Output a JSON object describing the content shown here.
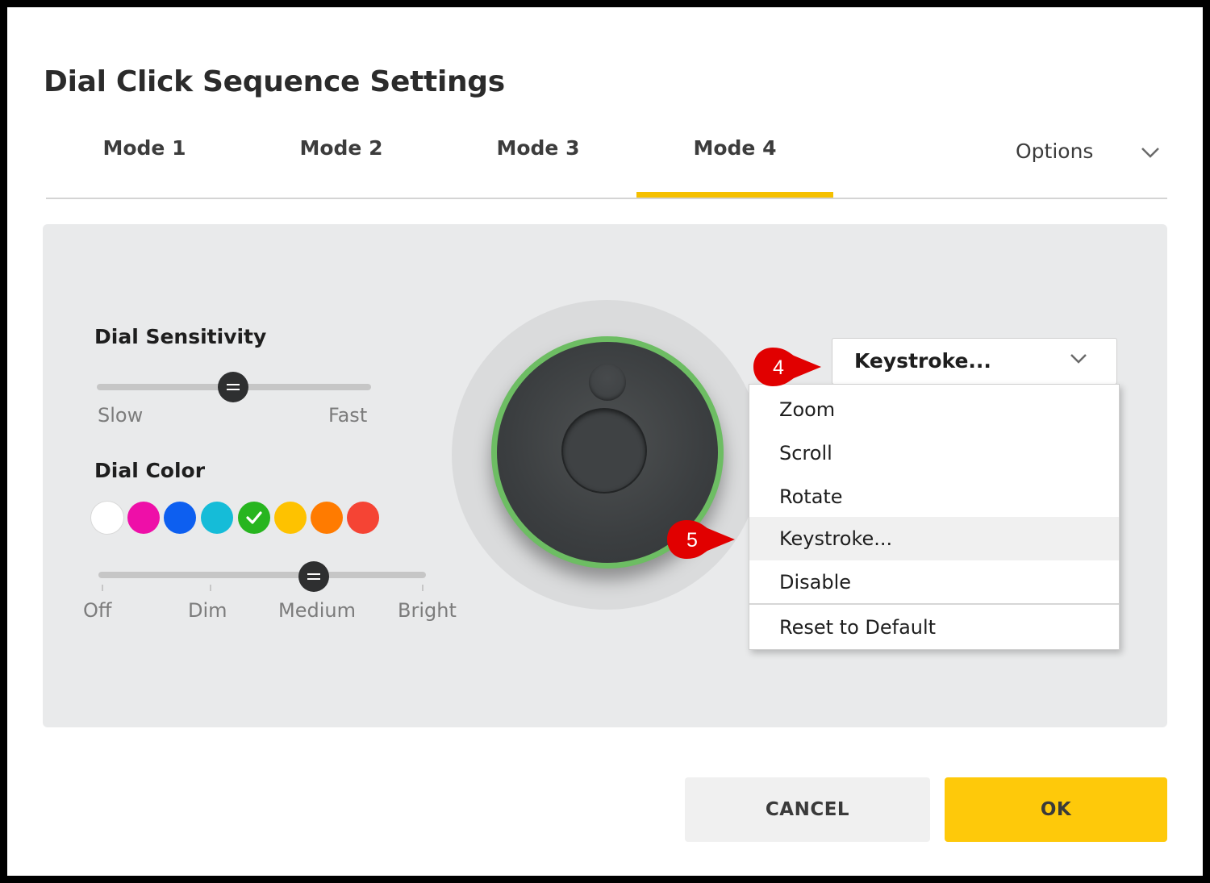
{
  "dialog": {
    "title": "Dial Click Sequence Settings"
  },
  "tabs": [
    {
      "label": "Mode 1",
      "active": false
    },
    {
      "label": "Mode 2",
      "active": false
    },
    {
      "label": "Mode 3",
      "active": false
    },
    {
      "label": "Mode 4",
      "active": true
    }
  ],
  "options": {
    "label": "Options",
    "icon": "chevron-down-icon"
  },
  "sensitivity": {
    "label": "Dial Sensitivity",
    "min_label": "Slow",
    "max_label": "Fast",
    "value_fraction": 0.5
  },
  "dial_color": {
    "label": "Dial Color",
    "selected": "#27b51f",
    "swatches": [
      "#ffffff",
      "#ee0fa8",
      "#0d5ff0",
      "#15bcd8",
      "#27b51f",
      "#fec200",
      "#ff7b00",
      "#f54434"
    ]
  },
  "brightness": {
    "levels": [
      "Off",
      "Dim",
      "Medium",
      "Bright"
    ],
    "selected": "Medium"
  },
  "action_select": {
    "value": "Keystroke...",
    "icon": "chevron-down-icon",
    "options": [
      "Zoom",
      "Scroll",
      "Rotate",
      "Keystroke...",
      "Disable",
      "Reset to Default"
    ],
    "highlighted": "Keystroke..."
  },
  "callouts": {
    "step4": "4",
    "step5": "5",
    "color": "#e10000"
  },
  "buttons": {
    "cancel": "CANCEL",
    "ok": "OK"
  },
  "colors": {
    "accent": "#fec90a",
    "dial_ring": "#6dbd63"
  }
}
